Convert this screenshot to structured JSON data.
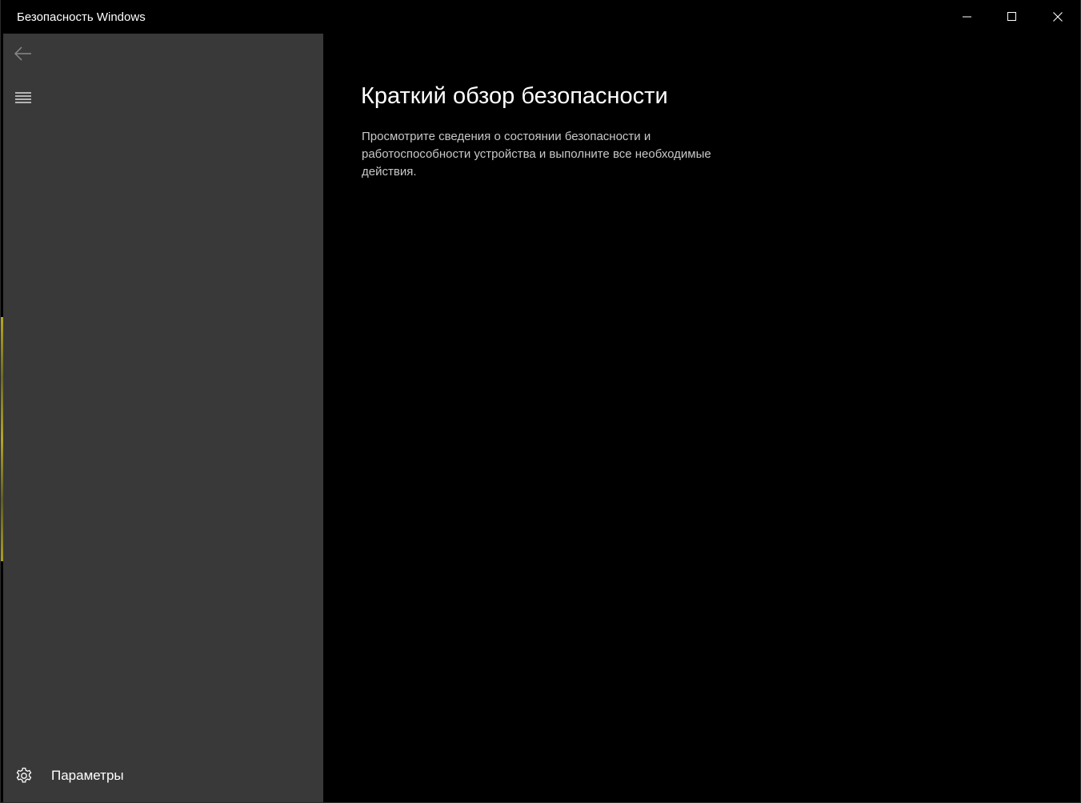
{
  "window": {
    "title": "Безопасность Windows"
  },
  "titlebar": {
    "buttons": [
      "minimize-icon",
      "maximize-icon",
      "close-icon"
    ]
  },
  "sidebar": {
    "back_icon": "back-arrow-icon",
    "menu_icon": "hamburger-menu-icon",
    "settings_label": "Параметры",
    "settings_icon": "gear-icon",
    "background_color": "#393939"
  },
  "main": {
    "title": "Краткий обзор безопасности",
    "description": "Просмотрите сведения о состоянии безопасности и работоспособности устройства и выполните все необходимые действия.",
    "background_color": "#000000"
  }
}
